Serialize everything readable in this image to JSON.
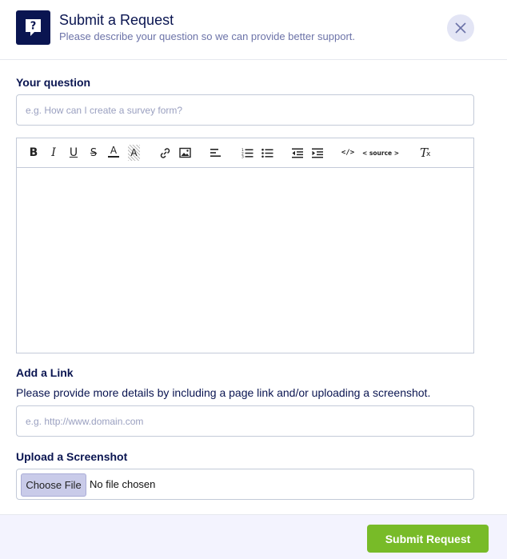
{
  "header": {
    "title": "Submit a Request",
    "subtitle": "Please describe your question so we can provide better support.",
    "logo_icon": "question-bubble-icon",
    "close_icon": "close-icon"
  },
  "question": {
    "label": "Your question",
    "placeholder": "e.g. How can I create a survey form?"
  },
  "editor": {
    "toolbar": [
      {
        "name": "bold-button",
        "icon": "bold-icon",
        "glyph": "B"
      },
      {
        "name": "italic-button",
        "icon": "italic-icon",
        "glyph": "I"
      },
      {
        "name": "underline-button",
        "icon": "underline-icon",
        "glyph": "U"
      },
      {
        "name": "strikethrough-button",
        "icon": "strikethrough-icon",
        "glyph": "S"
      },
      {
        "name": "font-color-button",
        "icon": "font-color-icon",
        "glyph": "A"
      },
      {
        "name": "highlight-button",
        "icon": "highlight-icon",
        "glyph": "A"
      },
      {
        "name": "link-button",
        "icon": "link-icon"
      },
      {
        "name": "image-button",
        "icon": "image-icon"
      },
      {
        "name": "align-button",
        "icon": "align-left-icon"
      },
      {
        "name": "ordered-list-button",
        "icon": "ordered-list-icon"
      },
      {
        "name": "unordered-list-button",
        "icon": "unordered-list-icon"
      },
      {
        "name": "outdent-button",
        "icon": "outdent-icon"
      },
      {
        "name": "indent-button",
        "icon": "indent-icon"
      },
      {
        "name": "code-button",
        "icon": "code-icon",
        "glyph": "</>"
      },
      {
        "name": "source-button",
        "icon": "source-icon",
        "glyph": "< source >"
      },
      {
        "name": "clear-format-button",
        "icon": "clear-format-icon",
        "glyph": "T"
      }
    ]
  },
  "link": {
    "label": "Add a Link",
    "hint": "Please provide more details by including a page link and/or uploading a screenshot.",
    "placeholder": "e.g. http://www.domain.com"
  },
  "screenshot": {
    "label": "Upload a Screenshot",
    "button_label": "Choose File",
    "status": "No file chosen"
  },
  "footer": {
    "submit_label": "Submit Request"
  },
  "colors": {
    "navy": "#0a1551",
    "accent_green": "#78bb28",
    "footer_bg": "#f3f3fe",
    "close_bg": "#e3e5f5"
  }
}
